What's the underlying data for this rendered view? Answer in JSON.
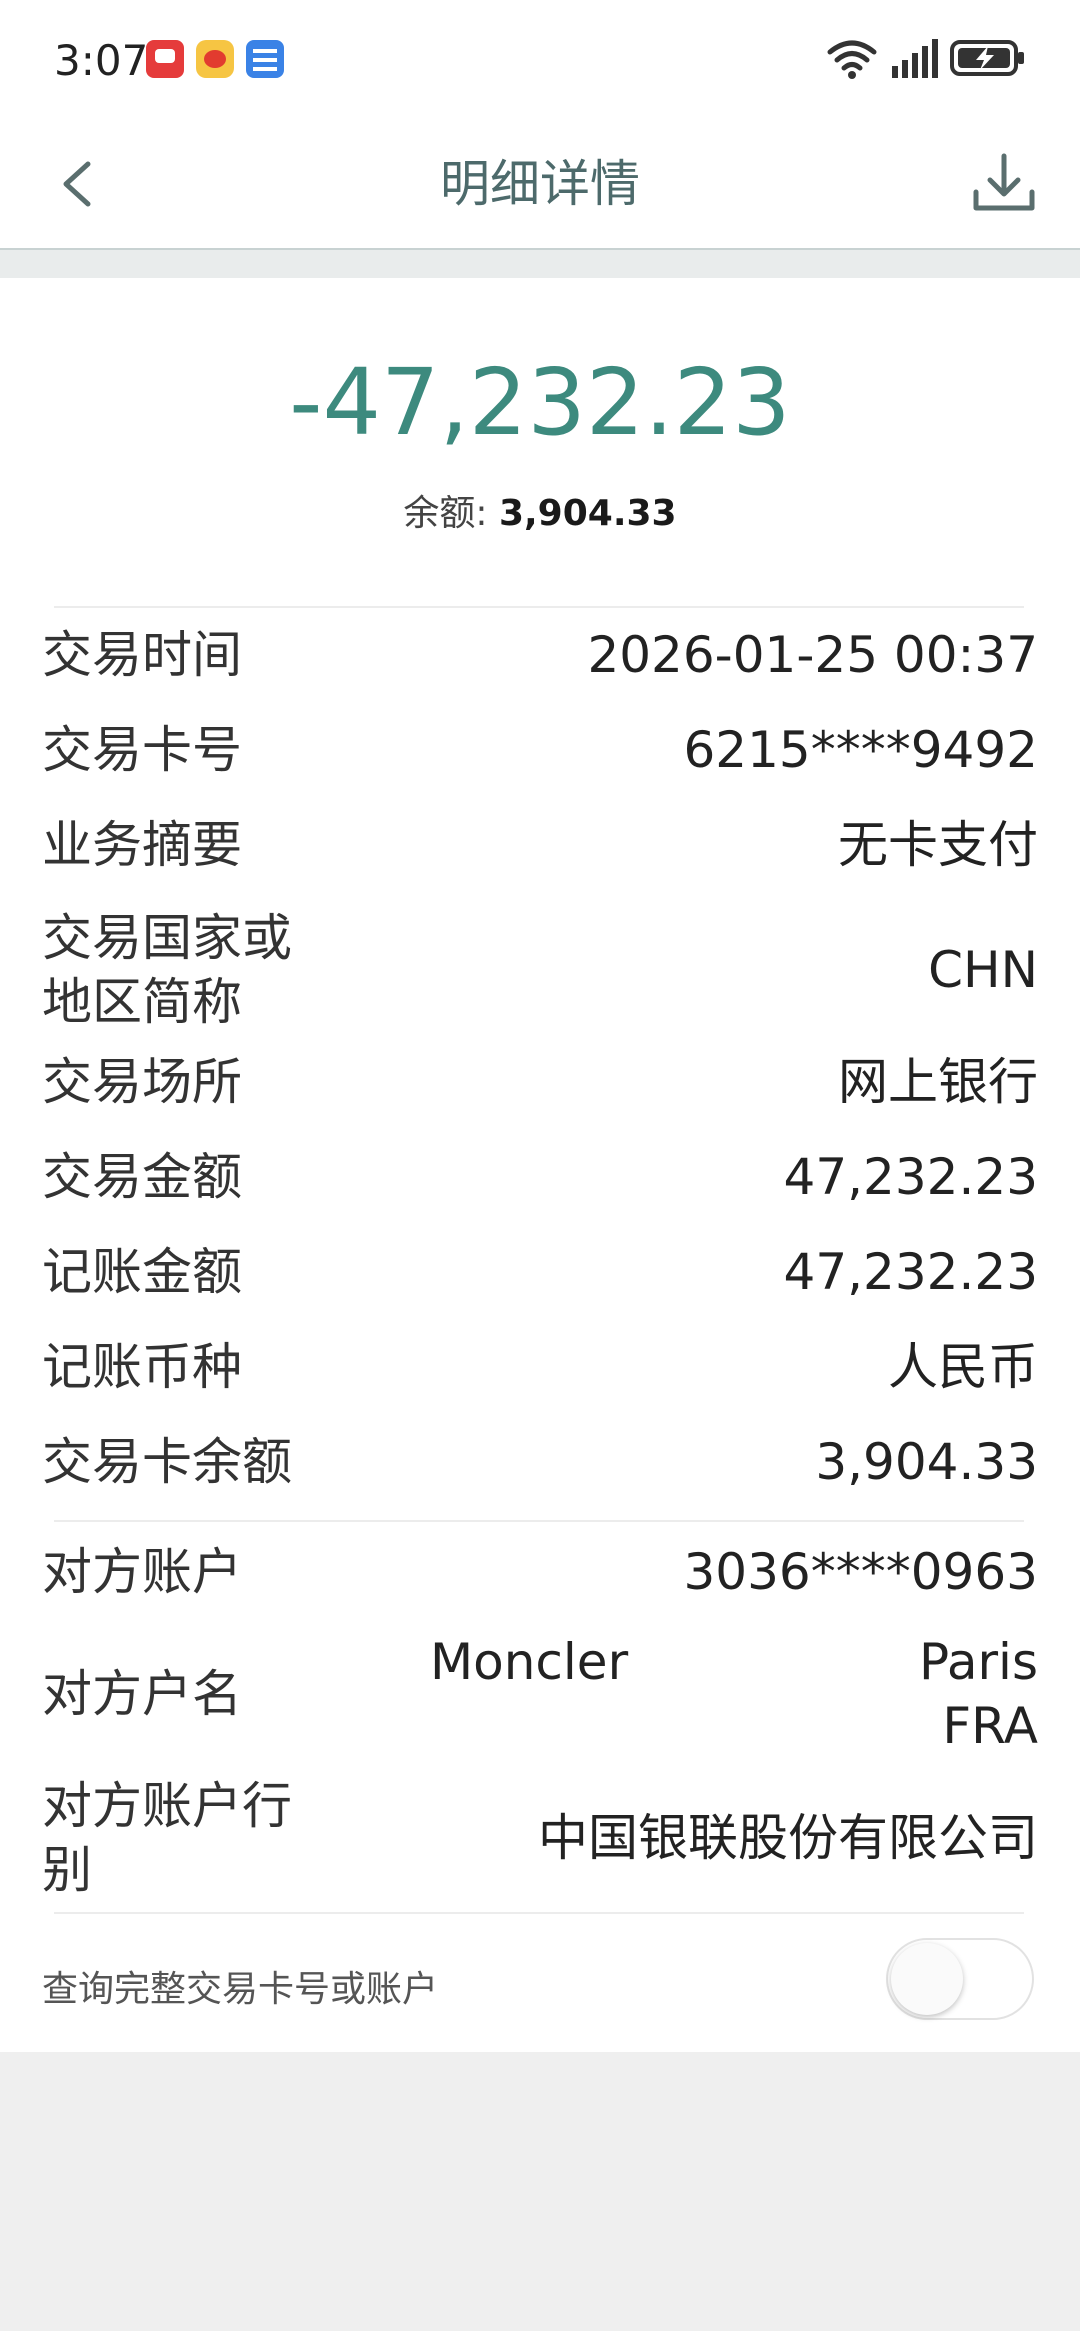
{
  "status_bar": {
    "time": "3:07",
    "notification_icons": [
      "video-app-icon",
      "weibo-icon",
      "live-stream-app-icon"
    ],
    "system_icons": [
      "wifi-icon",
      "signal-icon",
      "battery-charging-icon"
    ]
  },
  "header": {
    "title": "明细详情",
    "back_icon": "chevron-left-icon",
    "download_icon": "download-icon"
  },
  "summary": {
    "amount": "-47,232.23",
    "balance_label": "余额: ",
    "balance_value": "3,904.33"
  },
  "details": [
    {
      "label": "交易时间",
      "value": "2026-01-25 00:37"
    },
    {
      "label": "交易卡号",
      "value": "6215****9492"
    },
    {
      "label": "业务摘要",
      "value": "无卡支付"
    },
    {
      "label": "交易国家或\n地区简称",
      "value": "CHN"
    },
    {
      "label": "交易场所",
      "value": "网上银行"
    },
    {
      "label": "交易金额",
      "value": "47,232.23"
    },
    {
      "label": "记账金额",
      "value": "47,232.23"
    },
    {
      "label": "记账币种",
      "value": "人民币"
    },
    {
      "label": "交易卡余额",
      "value": "3,904.33"
    }
  ],
  "counterparty": {
    "account_label": "对方账户",
    "account_value": "3036****0963",
    "name_label": "对方户名",
    "name_part1": "Moncler",
    "name_part2": "Paris",
    "name_part3": "FRA",
    "bank_label": "对方账户行\n别",
    "bank_value": "中国银联股份有限公司"
  },
  "toggle": {
    "label": "查询完整交易卡号或账户",
    "state": "off"
  },
  "colors": {
    "amount": "#3d8a7e",
    "title": "#4d6a6b",
    "background": "#efefef"
  }
}
